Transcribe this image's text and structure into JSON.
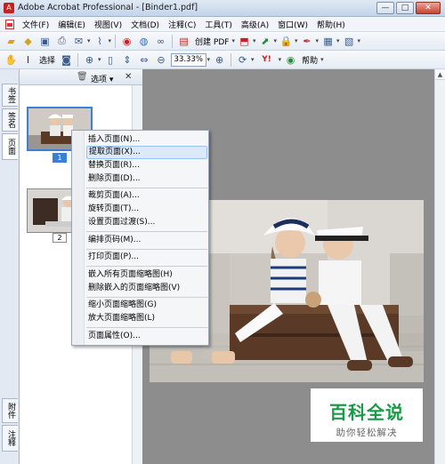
{
  "window": {
    "title": "Adobe Acrobat Professional - [Binder1.pdf]",
    "min": "—",
    "max": "□",
    "close": "✕"
  },
  "menubar": [
    "文件(F)",
    "编辑(E)",
    "视图(V)",
    "文档(D)",
    "注释(C)",
    "工具(T)",
    "高级(A)",
    "窗口(W)",
    "帮助(H)"
  ],
  "toolbar1": {
    "create_pdf": "创建 PDF"
  },
  "toolbar2": {
    "select": "选择",
    "zoom": "33.33%",
    "help": "帮助"
  },
  "left_tabs": {
    "bookmarks": "书签",
    "signatures": "签名",
    "pages": "页面",
    "attachments": "附件",
    "comments": "注释"
  },
  "nav_panel": {
    "options": "选项",
    "pages": [
      "1",
      "2"
    ]
  },
  "context_menu": {
    "items": [
      "插入页面(N)...",
      "提取页面(X)...",
      "替换页面(R)...",
      "删除页面(D)...",
      "裁剪页面(A)...",
      "旋转页面(T)...",
      "设置页面过渡(S)...",
      "编排页码(M)...",
      "打印页面(P)...",
      "嵌入所有页面缩略图(H)",
      "删除嵌入的页面缩略图(V)",
      "缩小页面缩略图(G)",
      "放大页面缩略图(L)",
      "页面属性(O)..."
    ],
    "highlighted_index": 1
  },
  "watermark": {
    "title": "百科全说",
    "subtitle": "助你轻松解决"
  },
  "colors": {
    "accent": "#3d7fd6",
    "watermark_green": "#1a9a48"
  }
}
